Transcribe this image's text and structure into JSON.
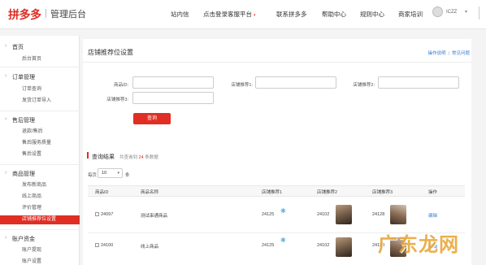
{
  "header": {
    "logo": "拼多多",
    "subtitle": "管理后台",
    "nav": [
      {
        "label": "站内信",
        "icon": ""
      },
      {
        "label": "点击登录客服平台",
        "icon": "bell-icon"
      },
      {
        "label": "联系拼多多",
        "icon": ""
      },
      {
        "label": "帮助中心",
        "icon": ""
      },
      {
        "label": "规则中心",
        "icon": ""
      },
      {
        "label": "商家培训",
        "icon": ""
      }
    ],
    "user_name": "ICZZ"
  },
  "sidebar": {
    "groups": [
      {
        "title": "首页",
        "items": [
          "后台首页"
        ]
      },
      {
        "title": "订单管理",
        "items": [
          "订单查询",
          "发货订单导入"
        ]
      },
      {
        "title": "售后管理",
        "items": [
          "退款/售后",
          "售后服务质量",
          "售后设置"
        ]
      },
      {
        "title": "商品管理",
        "items": [
          "发布新商品",
          "线上商品",
          "评价管理",
          "店铺推荐位设置"
        ]
      },
      {
        "title": "账户资金",
        "items": [
          "账户提现",
          "账户设置"
        ]
      }
    ],
    "active_item": "店铺推荐位设置"
  },
  "main": {
    "title": "店铺推荐位设置",
    "links": [
      "操作说明",
      "常见问题"
    ],
    "filters": {
      "goods_id_label": "商品ID:",
      "rec1_label": "店铺推荐1:",
      "rec2_label": "店铺推荐2:",
      "rec3_label": "店铺推荐3:"
    },
    "query_button": "查询",
    "results": {
      "title": "查询结果",
      "count_prefix": "共查询到",
      "count": "24",
      "count_suffix": "条数据"
    },
    "per_page": {
      "label": "每页",
      "value": "10",
      "unit": "条"
    },
    "table": {
      "headers": [
        "商品ID",
        "商品名称",
        "店铺推荐1",
        "店铺推荐2",
        "店铺推荐3",
        "操作"
      ],
      "rows": [
        {
          "id": "24097",
          "name": "测试串通商品",
          "rec1": "24125",
          "rec2": "24102",
          "rec3": "24128",
          "action": "编辑"
        },
        {
          "id": "24100",
          "name": "线上商品",
          "rec1": "24125",
          "rec2": "24102",
          "rec3": "24128",
          "action": "编辑"
        }
      ]
    }
  },
  "watermark": "广东龙网"
}
